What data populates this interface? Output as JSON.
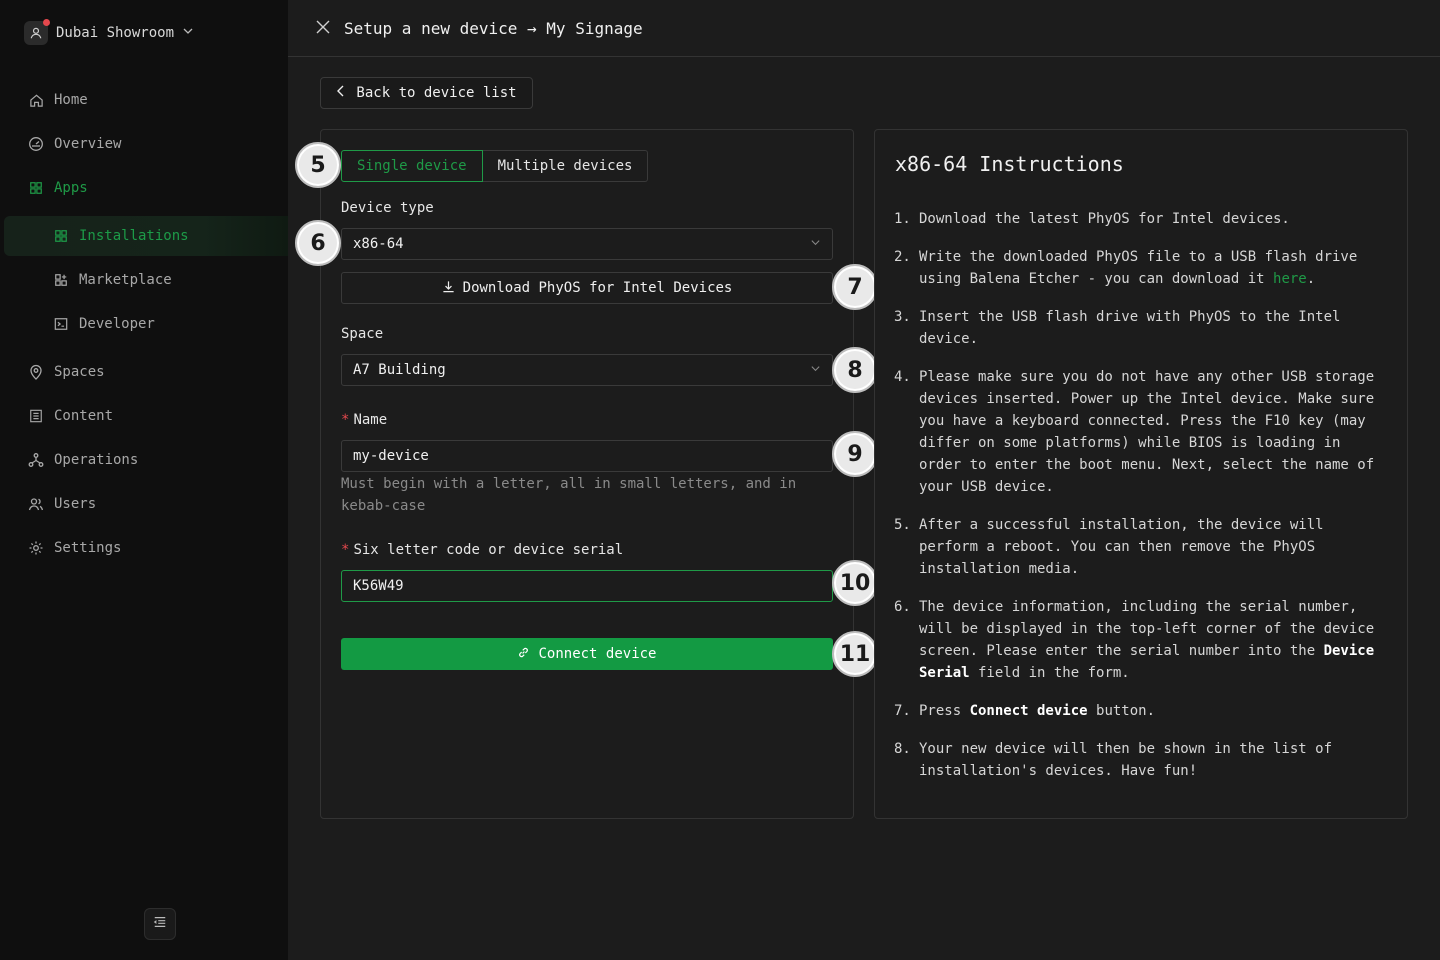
{
  "sidebar": {
    "org_name": "Dubai Showroom",
    "items": [
      {
        "label": "Home",
        "icon": "home-icon"
      },
      {
        "label": "Overview",
        "icon": "gauge-icon"
      },
      {
        "label": "Apps",
        "icon": "grid-icon"
      },
      {
        "label": "Installations",
        "icon": "grid-icon"
      },
      {
        "label": "Marketplace",
        "icon": "grid-plus-icon"
      },
      {
        "label": "Developer",
        "icon": "terminal-icon"
      },
      {
        "label": "Spaces",
        "icon": "map-pin-icon"
      },
      {
        "label": "Content",
        "icon": "file-list-icon"
      },
      {
        "label": "Operations",
        "icon": "nodes-icon"
      },
      {
        "label": "Users",
        "icon": "users-icon"
      },
      {
        "label": "Settings",
        "icon": "gear-icon"
      }
    ]
  },
  "header": {
    "title": "Setup a new device → My Signage"
  },
  "back_button": "Back to device list",
  "tabs": {
    "single": "Single device",
    "multiple": "Multiple devices"
  },
  "form": {
    "device_type_label": "Device type",
    "device_type_value": "x86-64",
    "download_label": "Download PhyOS for Intel Devices",
    "space_label": "Space",
    "space_value": "A7 Building",
    "name_label": "Name",
    "name_value": "my-device",
    "name_help": "Must begin with a letter, all in small letters, and in kebab-case",
    "serial_label": "Six letter code or device serial",
    "serial_value": "K56W49",
    "connect_label": "Connect device",
    "required_mark": "*"
  },
  "callouts": [
    "5",
    "6",
    "7",
    "8",
    "9",
    "10",
    "11"
  ],
  "instructions": {
    "title": "x86-64 Instructions",
    "steps": [
      {
        "num": "1.",
        "parts": [
          "Download the latest PhyOS for Intel devices."
        ]
      },
      {
        "num": "2.",
        "parts": [
          "Write the downloaded PhyOS file to a USB flash drive using Balena Etcher - you can download it ",
          "here",
          "."
        ]
      },
      {
        "num": "3.",
        "parts": [
          "Insert the USB flash drive with PhyOS to the Intel device."
        ]
      },
      {
        "num": "4.",
        "parts": [
          "Please make sure you do not have any other USB storage devices inserted. Power up the Intel device. Make sure you have a keyboard connected. Press the F10 key (may differ on some platforms) while BIOS is loading in order to enter the boot menu. Next, select the name of your USB device."
        ]
      },
      {
        "num": "5.",
        "parts": [
          "After a successful installation, the device will perform a reboot. You can then remove the PhyOS installation media."
        ]
      },
      {
        "num": "6.",
        "parts": [
          "The device information, including the serial number, will be displayed in the top-left corner of the device screen. Please enter the serial number into the ",
          "Device Serial",
          " field in the form."
        ]
      },
      {
        "num": "7.",
        "parts": [
          "Press ",
          "Connect device",
          " button."
        ]
      },
      {
        "num": "8.",
        "parts": [
          "Your new device will then be shown in the list of installation's devices. Have fun!"
        ]
      }
    ]
  },
  "colors": {
    "accent": "#139a43",
    "background": "#1c1c1c",
    "sidebar": "#0f0f0f"
  }
}
